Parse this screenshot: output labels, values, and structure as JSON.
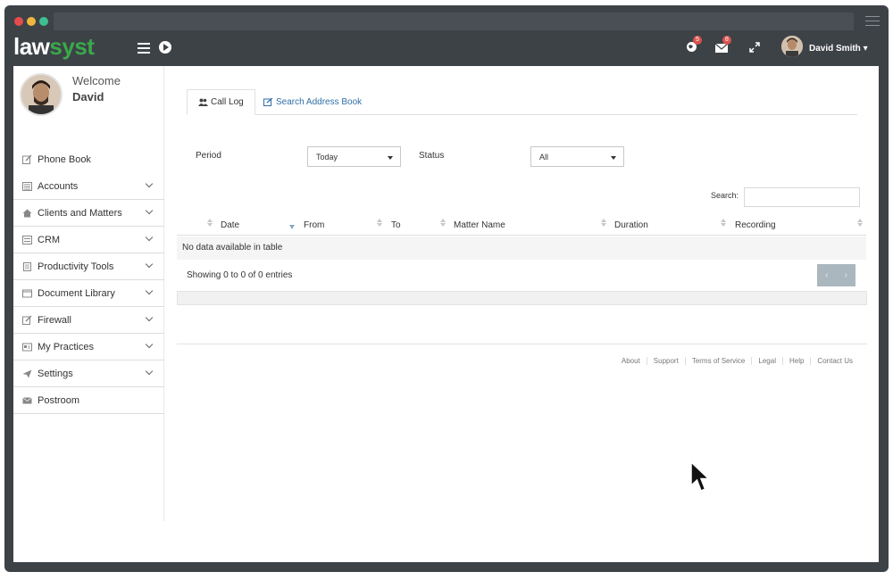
{
  "colors": {
    "accent": "#3aa84a",
    "header_bg": "#3d4247",
    "link": "#2f6fa6",
    "badge": "#d9534f"
  },
  "browser": {
    "dots": [
      "#e74c4c",
      "#f0b63c",
      "#3fbf8f"
    ]
  },
  "brand": {
    "part1": "law",
    "part2": "syst"
  },
  "header": {
    "notifications_badge": "5",
    "messages_badge": "8",
    "user_name": "David Smith ▾",
    "icons": [
      "menu-icon",
      "play-icon",
      "globe-icon",
      "mail-icon",
      "expand-icon"
    ]
  },
  "profile": {
    "welcome": "Welcome",
    "name": "David"
  },
  "sidebar": {
    "items": [
      {
        "label": "Phone Book",
        "icon": "edit-icon"
      },
      {
        "label": "Accounts",
        "icon": "calculator-icon"
      },
      {
        "label": "Clients and Matters",
        "icon": "home-icon"
      },
      {
        "label": "CRM",
        "icon": "list-icon"
      },
      {
        "label": "Productivity Tools",
        "icon": "document-icon"
      },
      {
        "label": "Document Library",
        "icon": "book-icon"
      },
      {
        "label": "Firewall",
        "icon": "edit-icon"
      },
      {
        "label": "My Practices",
        "icon": "card-icon"
      },
      {
        "label": "Settings",
        "icon": "send-icon"
      },
      {
        "label": "Postroom",
        "icon": "envelope-icon"
      }
    ]
  },
  "tabs": {
    "call_log": "Call Log",
    "search_address_book": "Search Address Book"
  },
  "filters": {
    "period_label": "Period",
    "period_value": "Today",
    "status_label": "Status",
    "status_value": "All"
  },
  "search": {
    "label": "Search:"
  },
  "table": {
    "columns": [
      "Date",
      "From",
      "To",
      "Matter Name",
      "Duration",
      "Recording"
    ],
    "empty_message": "No data available in table",
    "info": "Showing 0 to 0 of 0 entries",
    "pager_prev": "‹",
    "pager_next": "›"
  },
  "footer": {
    "links": [
      "About",
      "Support",
      "Terms of Service",
      "Legal",
      "Help",
      "Contact Us"
    ]
  }
}
